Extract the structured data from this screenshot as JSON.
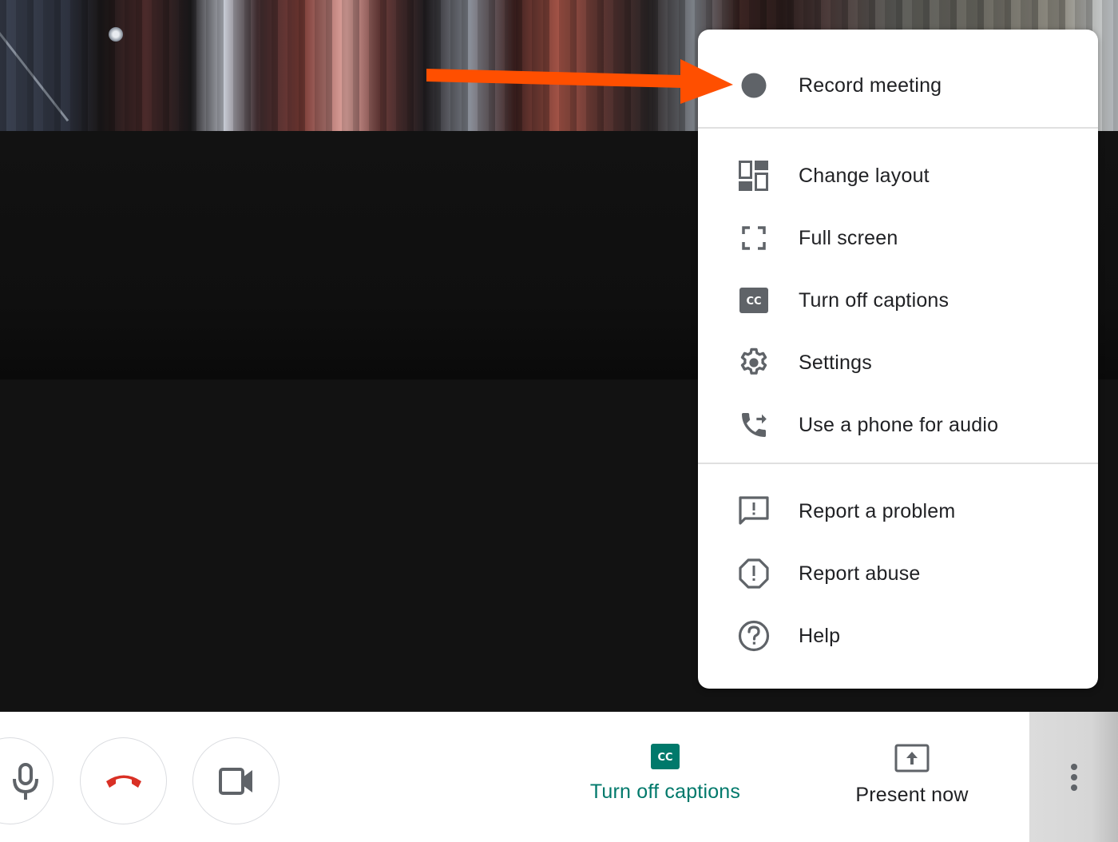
{
  "colors": {
    "accent_captions": "#00796b",
    "hangup_red": "#d93025",
    "icon_gray": "#5f6368",
    "annotation_arrow": "#ff4f00",
    "menu_text": "#202124"
  },
  "menu": {
    "sections": [
      {
        "items": [
          {
            "label": "Record meeting",
            "icon": "record-dot-icon"
          }
        ]
      },
      {
        "items": [
          {
            "label": "Change layout",
            "icon": "layout-icon"
          },
          {
            "label": "Full screen",
            "icon": "fullscreen-icon"
          },
          {
            "label": "Turn off captions",
            "icon": "closed-captions-icon"
          },
          {
            "label": "Settings",
            "icon": "gear-icon"
          },
          {
            "label": "Use a phone for audio",
            "icon": "phone-forward-icon"
          }
        ]
      },
      {
        "items": [
          {
            "label": "Report a problem",
            "icon": "feedback-icon"
          },
          {
            "label": "Report abuse",
            "icon": "report-octagon-icon"
          },
          {
            "label": "Help",
            "icon": "help-circle-icon"
          }
        ]
      }
    ]
  },
  "toolbar": {
    "mic_icon": "microphone-icon",
    "hangup_icon": "hang-up-icon",
    "camera_icon": "video-camera-icon",
    "captions": {
      "label": "Turn off captions",
      "icon": "closed-captions-icon",
      "badge": "CC"
    },
    "present": {
      "label": "Present now",
      "icon": "present-screen-icon"
    },
    "more_icon": "more-vertical-icon"
  },
  "annotation": {
    "type": "arrow",
    "points_to": "Record meeting"
  }
}
